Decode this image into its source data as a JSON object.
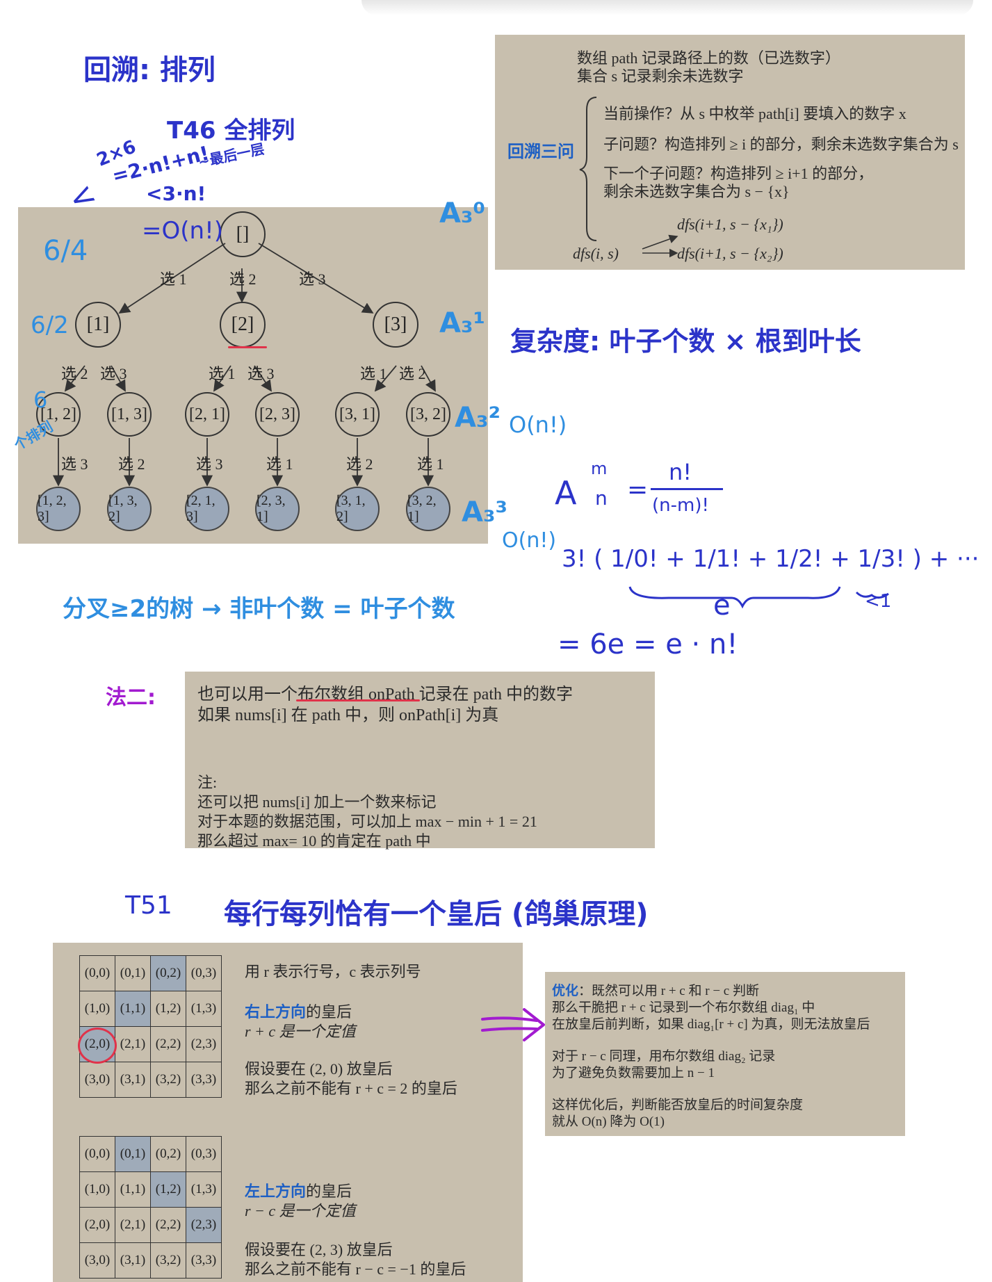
{
  "notes": {
    "title": "回溯: 排列",
    "t46": "T46 全排列",
    "calc_line1": "2×6",
    "calc_line2": "=2·n!+n!",
    "calc_line2_note": "~最后一层",
    "calc_line3": "<3·n!",
    "calc_lt": "<",
    "calc_on": "=O(n!)",
    "n64": "6/4",
    "n62": "6/2",
    "n6": "6",
    "side_note": "个排列",
    "a30": "A₃⁰",
    "a31": "A₃¹",
    "a32": "A₃²",
    "a33": "A₃³",
    "complexity": "复杂度: 叶子个数 × 根到叶长",
    "on1": "O(n!)",
    "on2": "O(n!)",
    "perm_A": "A",
    "perm_m": "m",
    "perm_n": "n",
    "perm_eq": "=",
    "perm_num": "n!",
    "perm_den": "(n-m)!",
    "series": "3! ( 1/0! + 1/1! + 1/2! + 1/3! ) + ···",
    "series_e": "e",
    "series_lt1": "<1",
    "result": "= 6e  = e · n!",
    "branch": "分叉≥2的树 → 非叶个数 = 叶子个数",
    "method2": "法二:",
    "t51": "T51",
    "t51_desc": "每行每列恰有一个皇后 (鸽巢原理)"
  },
  "top_panel": {
    "line1": "数组 path 记录路径上的数（已选数字）",
    "line2": "集合 s 记录剩余未选数字",
    "label": "回溯三问",
    "q1": "当前操作？从 s 中枚举 path[i] 要填入的数字 x",
    "q2": "子问题？构造排列 ≥ i 的部分，剩余未选数字集合为 s",
    "q3a": "下一个子问题？构造排列 ≥ i+1 的部分，",
    "q3b": "剩余未选数字集合为 s − {x}",
    "dfs1": "dfs(i+1, s − {x₁})",
    "dfs0": "dfs(i, s)",
    "dfs2": "dfs(i+1, s − {x₂})"
  },
  "tree": {
    "root": "[]",
    "level1": [
      "[1]",
      "[2]",
      "[3]"
    ],
    "edge1": [
      "选 1",
      "选 2",
      "选 3"
    ],
    "level2": [
      "[1, 2]",
      "[1, 3]",
      "[2, 1]",
      "[2, 3]",
      "[3, 1]",
      "[3, 2]"
    ],
    "edge2": [
      "选 2",
      "选 3",
      "选 1",
      "选 3",
      "选 1",
      "选 2"
    ],
    "leaves": [
      "[1, 2, 3]",
      "[1, 3, 2]",
      "[2, 1, 3]",
      "[2, 3, 1]",
      "[3, 1, 2]",
      "[3, 2, 1]"
    ],
    "edge3": [
      "选 3",
      "选 2",
      "选 3",
      "选 1",
      "选 2",
      "选 1"
    ]
  },
  "mid_panel": {
    "line1": "也可以用一个布尔数组 onPath 记录在 path 中的数字",
    "line2": "如果 nums[i] 在 path 中，则 onPath[i] 为真",
    "note": "注:",
    "note1": "还可以把 nums[i] 加上一个数来标记",
    "note2": "对于本题的数据范围，可以加上 max − min + 1 = 21",
    "note3": "那么超过 max= 10 的肯定在 path 中"
  },
  "queens_panel": {
    "grid1": [
      [
        "(0,0)",
        "(0,1)",
        "(0,2)",
        "(0,3)"
      ],
      [
        "(1,0)",
        "(1,1)",
        "(1,2)",
        "(1,3)"
      ],
      [
        "(2,0)",
        "(2,1)",
        "(2,2)",
        "(2,3)"
      ],
      [
        "(3,0)",
        "(3,1)",
        "(3,2)",
        "(3,3)"
      ]
    ],
    "grid2": [
      [
        "(0,0)",
        "(0,1)",
        "(0,2)",
        "(0,3)"
      ],
      [
        "(1,0)",
        "(1,1)",
        "(1,2)",
        "(1,3)"
      ],
      [
        "(2,0)",
        "(2,1)",
        "(2,2)",
        "(2,3)"
      ],
      [
        "(3,0)",
        "(3,1)",
        "(3,2)",
        "(3,3)"
      ]
    ],
    "intro": "用 r 表示行号，c 表示列号",
    "upright_title": "右上方向",
    "upright_suffix": "的皇后",
    "upright_desc": "r + c 是一个定值",
    "upright_ex1": "假设要在 (2, 0) 放皇后",
    "upright_ex2": "那么之前不能有 r + c = 2 的皇后",
    "upleft_title": "左上方向",
    "upleft_suffix": "的皇后",
    "upleft_desc": "r − c 是一个定值",
    "upleft_ex1": "假设要在 (2, 3) 放皇后",
    "upleft_ex2": "那么之前不能有 r − c = −1 的皇后"
  },
  "opt_panel": {
    "title": "优化",
    "l1": "：既然可以用 r + c 和 r − c 判断",
    "l2": "那么干脆把 r + c 记录到一个布尔数组 diag₁ 中",
    "l3": "在放皇后前判断，如果 diag₁[r + c] 为真，则无法放皇后",
    "l4": "对于 r − c 同理，用布尔数组 diag₂ 记录",
    "l5": "为了避免负数需要加上 n − 1",
    "l6": "这样优化后，判断能否放皇后的时间复杂度",
    "l7": "就从 O(n) 降为 O(1)"
  },
  "colors": {
    "panel_bg": "#c8bfae",
    "handwriting_blue": "#2b33c9",
    "handwriting_lightblue": "#2f8ee0",
    "handwriting_purple": "#a21bd0",
    "highlight_cell": "#9fabb9",
    "leaf_node": "#9aa7b8",
    "accent_red": "#e0334a"
  }
}
